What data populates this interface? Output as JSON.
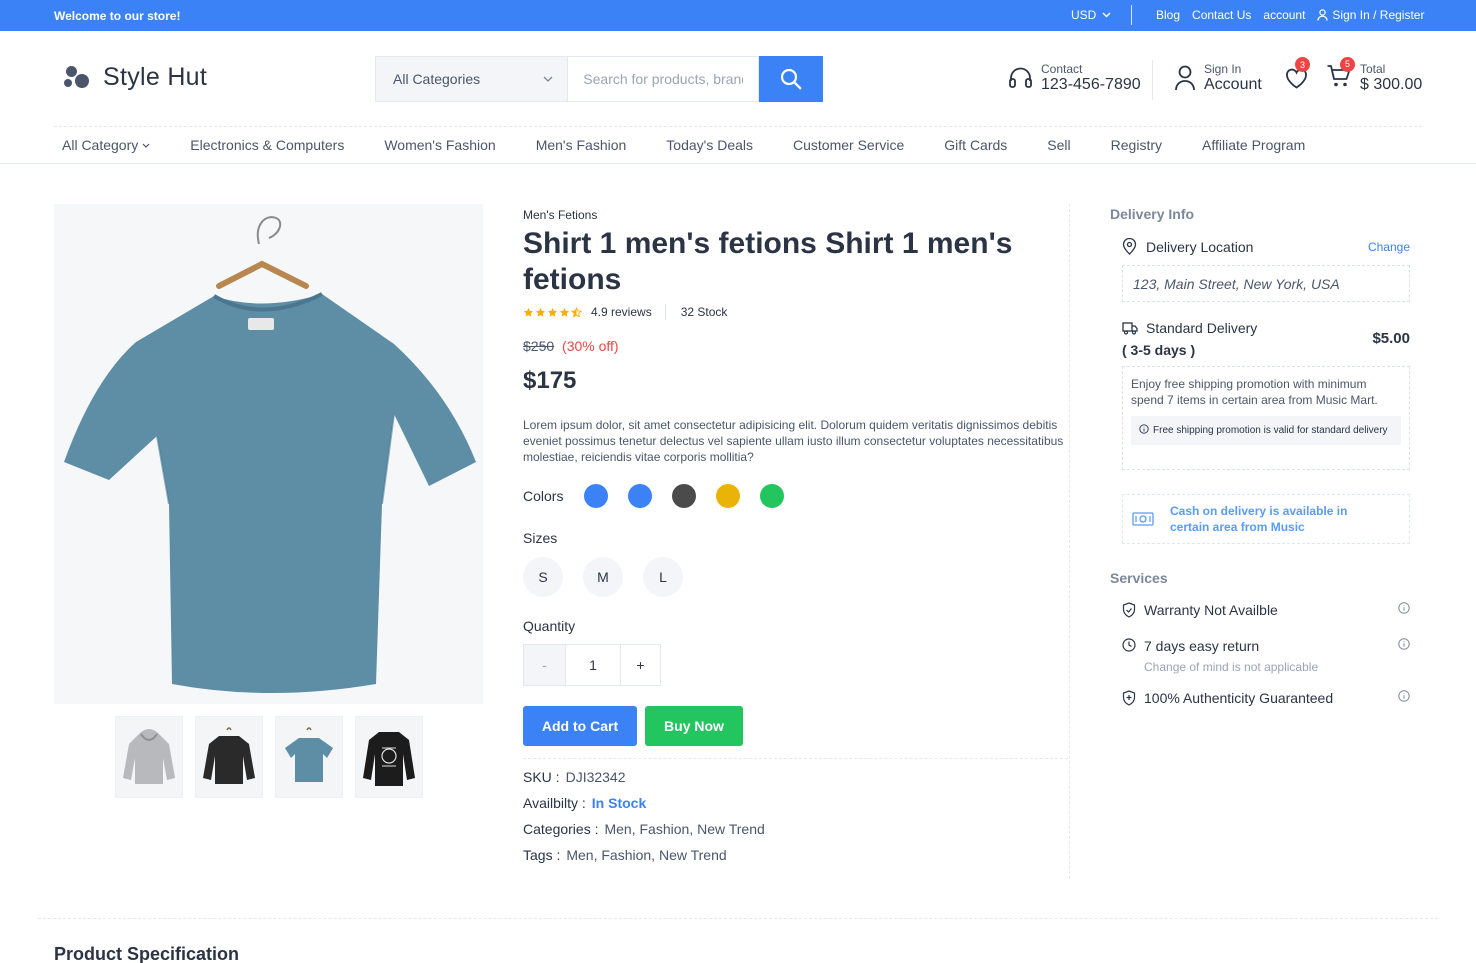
{
  "topbar": {
    "welcome": "Welcome to our store!",
    "currency": "USD",
    "links": [
      "Blog",
      "Contact Us",
      "account"
    ],
    "signin": "Sign In / Register"
  },
  "header": {
    "logo": "Style Hut",
    "category_select": "All Categories",
    "search_placeholder": "Search for products, brands",
    "contact_label": "Contact",
    "contact_phone": "123-456-7890",
    "account_label": "Sign In",
    "account_text": "Account",
    "wishlist_count": "3",
    "cart_count": "5",
    "cart_label": "Total",
    "cart_total": "$ 300.00"
  },
  "nav": {
    "first": "All Category",
    "items": [
      "Electronics & Computers",
      "Women's Fashion",
      "Men's Fashion",
      "Today's Deals",
      "Customer Service",
      "Gift Cards",
      "Sell",
      "Registry",
      "Affiliate Program"
    ]
  },
  "product": {
    "category": "Men's Fetions",
    "title": "Shirt 1 men's fetions Shirt 1 men's fetions",
    "rating_value": 4.5,
    "reviews": "4.9 reviews",
    "stock": "32 Stock",
    "old_price": "$250",
    "discount": "(30% off)",
    "price": "$175",
    "description": "Lorem ipsum dolor, sit amet consectetur adipisicing elit. Dolorum quidem veritatis dignissimos debitis eveniet possimus tenetur delectus vel sapiente ullam iusto illum consectetur voluptates necessitatibus molestiae, reiciendis vitae corporis mollitia?",
    "colors_label": "Colors",
    "colors": [
      "#3b82f6",
      "#3b82f6",
      "#4b4b4b",
      "#eab308",
      "#22c55e"
    ],
    "sizes_label": "Sizes",
    "sizes": [
      "S",
      "M",
      "L"
    ],
    "quantity_label": "Quantity",
    "qty_minus": "-",
    "qty_value": "1",
    "qty_plus": "+",
    "add_to_cart": "Add to Cart",
    "buy_now": "Buy Now",
    "sku_label": "SKU :",
    "sku": "DJI32342",
    "availability_label": "Availbilty :",
    "availability": "In Stock",
    "categories_label": "Categories :",
    "categories": "Men, Fashion, New Trend",
    "tags_label": "Tags :",
    "tags": "Men, Fashion, New Trend",
    "main_image_color": "#5e8da6",
    "thumbnails": [
      "hoodie-grey",
      "sweatshirt-black",
      "tshirt-blue",
      "sweatshirt-black-print"
    ]
  },
  "sidebar": {
    "delivery_title": "Delivery Info",
    "location_label": "Delivery Location",
    "change": "Change",
    "address": "123, Main Street, New York, USA",
    "standard_label": "Standard Delivery",
    "standard_days": "( 3-5 days )",
    "standard_fee": "$5.00",
    "promo_text": "Enjoy free shipping promotion with minimum spend 7 items in certain area from Music Mart.",
    "promo_note": "Free shipping promotion is valid for standard delivery",
    "cod_text": "Cash on delivery is available in certain area from Music",
    "services_title": "Services",
    "services": [
      {
        "label": "Warranty Not Availble",
        "sub": ""
      },
      {
        "label": "7 days easy return",
        "sub": "Change of mind is not applicable"
      },
      {
        "label": "100% Authenticity Guaranteed",
        "sub": ""
      }
    ]
  },
  "section": {
    "spec_title": "Product Specification"
  }
}
